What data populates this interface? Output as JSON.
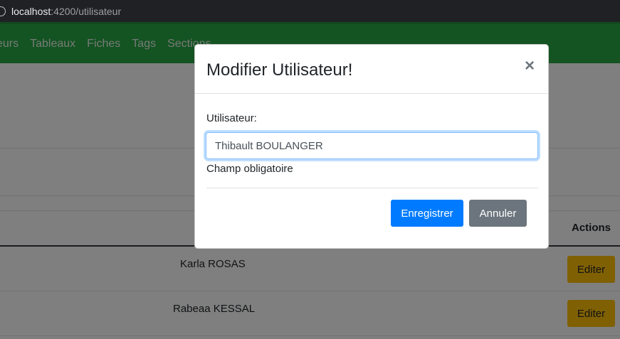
{
  "browser": {
    "url_host": "localhost",
    "url_path": ":4200/utilisateur"
  },
  "navbar": {
    "items": [
      "eurs",
      "Tableaux",
      "Fiches",
      "Tags",
      "Sections"
    ]
  },
  "table": {
    "actions_header": "Actions",
    "rows": [
      {
        "name": "Karla ROSAS",
        "edit_label": "Editer"
      },
      {
        "name": "Rabeaa KESSAL",
        "edit_label": "Editer"
      }
    ]
  },
  "modal": {
    "title": "Modifier Utilisateur!",
    "close_glyph": "×",
    "field_label": "Utilisateur:",
    "field_value": "Thibault BOULANGER",
    "help_text": "Champ obligatoire",
    "save_label": "Enregistrer",
    "cancel_label": "Annuler"
  },
  "colors": {
    "navbar": "#28a745",
    "primary": "#007bff",
    "secondary": "#6c757d",
    "warning": "#ffc107"
  }
}
